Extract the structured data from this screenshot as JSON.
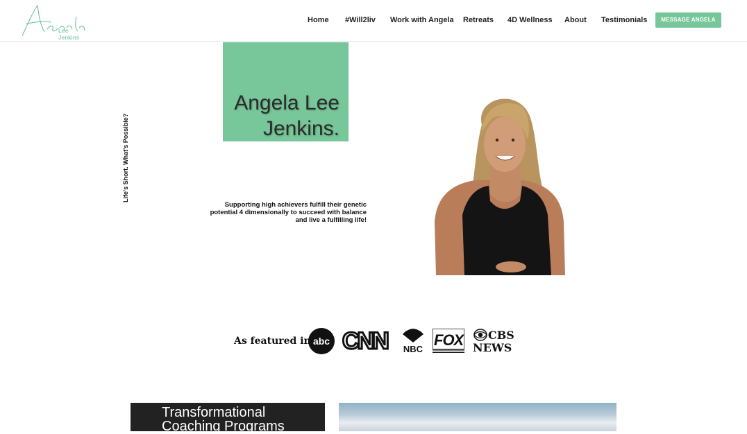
{
  "header": {
    "logo_script": "Angela",
    "logo_sub": "Lee Jenkins",
    "nav": [
      "Home",
      "#Will2liv",
      "Work with Angela",
      "Retreats",
      "4D Wellness",
      "About",
      "Testimonials"
    ],
    "cta_label": "MESSAGE ANGELA"
  },
  "hero": {
    "vertical_tagline": "Life's Short. What's Possible?",
    "name_line1": "Angela Lee",
    "name_line2": "Jenkins.",
    "support_text": "Supporting high achievers fulfill their genetic potential 4 dimensionally to succeed with balance and live a fulfilling life!"
  },
  "featured": {
    "label": "As featured in:",
    "logos": {
      "abc": "abc",
      "cnn": "CNN",
      "nbc": "NBC",
      "fox": "FOX",
      "cbs_line1": "CBS",
      "cbs_line2": "NEWS"
    }
  },
  "programs": {
    "title": "Transformational Coaching Programs"
  },
  "colors": {
    "brand_green": "#78c79a",
    "dark_panel": "#222222"
  },
  "icons": [
    "peacock-icon",
    "cbs-eye-icon"
  ]
}
